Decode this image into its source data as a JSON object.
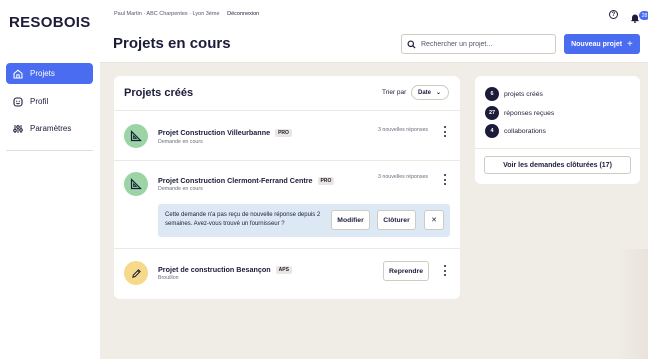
{
  "brand": {
    "name": "RESOBOIS"
  },
  "sidebar": {
    "items": [
      {
        "label": "Projets",
        "icon": "home-icon",
        "active": true
      },
      {
        "label": "Profil",
        "icon": "smile-icon",
        "active": false
      },
      {
        "label": "Paramètres",
        "icon": "sliders-icon",
        "active": false
      }
    ]
  },
  "header": {
    "user_line": "Paul Martin · ABC Charpentes · Lyon 3ème",
    "logout_label": "Déconnexion",
    "title": "Projets en cours",
    "search_placeholder": "Rechercher un projet...",
    "new_project_label": "Nouveau projet",
    "help_glyph": "?",
    "notifications_count": "28"
  },
  "projects_card": {
    "title": "Projets créés",
    "sort_label": "Trier par",
    "sort_value": "Date",
    "projects": [
      {
        "name": "Projet Construction Villeurbanne",
        "tag": "PRO",
        "status": "Demande en cours",
        "replies": "3 nouvelles réponses",
        "icon": "set-square-icon"
      },
      {
        "name": "Projet Construction Clermont-Ferrand Centre",
        "tag": "PRO",
        "status": "Demande en cours",
        "replies": "3 nouvelles réponses",
        "icon": "set-square-icon"
      },
      {
        "name": "Projet de construction Besançon",
        "tag": "APS",
        "status": "Brouillon",
        "action_label": "Reprendre",
        "icon": "pencil-icon"
      }
    ],
    "alert": {
      "text": "Cette demande n'a pas reçu de nouvelle réponse depuis 2 semaines. Avez-vous trouvé un fournisseur ?",
      "modify_label": "Modifier",
      "close_label": "Clôturer",
      "dismiss_glyph": "✕"
    }
  },
  "stats": {
    "items": [
      {
        "value": "6",
        "label": "projets créés"
      },
      {
        "value": "27",
        "label": "réponses reçues"
      },
      {
        "value": "4",
        "label": "collaborations"
      }
    ],
    "closed_button_label": "Voir les demandes clôturées (17)"
  },
  "colors": {
    "accent": "#4a6cf0",
    "dark": "#1c1c3a",
    "background": "#f0ece6",
    "green": "#9bd5a5",
    "yellow": "#f6d98a",
    "alert_bg": "#dde8f5"
  }
}
